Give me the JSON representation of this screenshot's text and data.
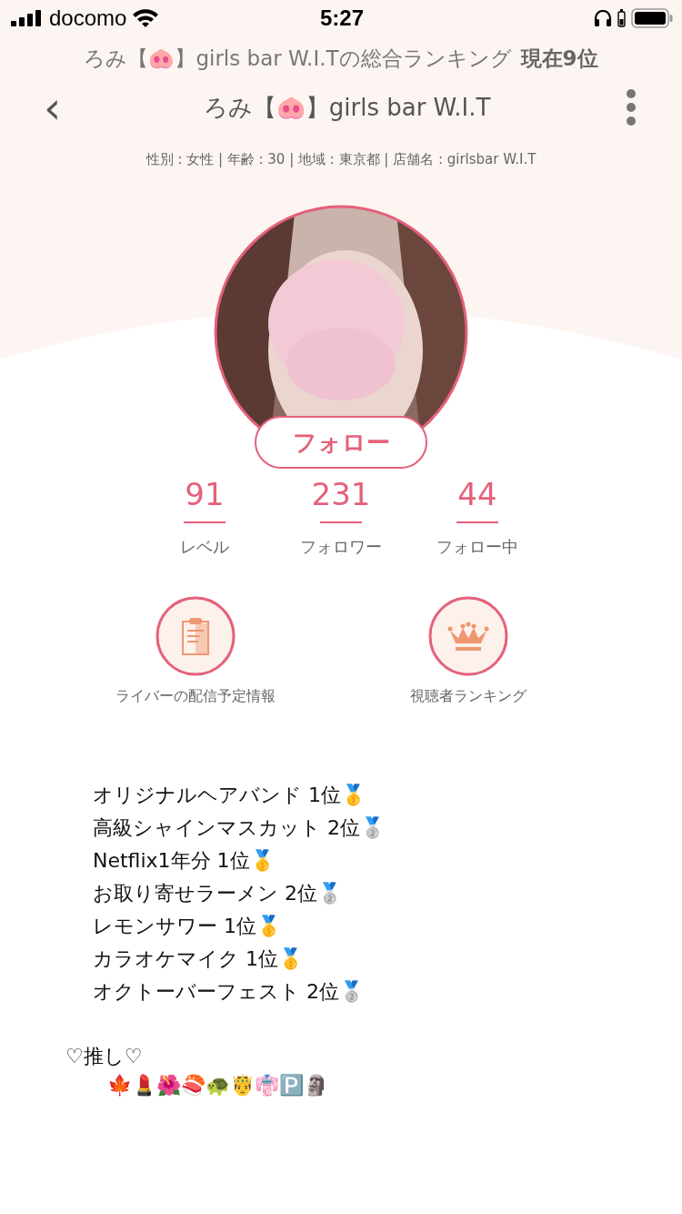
{
  "status_bar": {
    "carrier": "docomo",
    "time": "5:27"
  },
  "ranking_banner": {
    "text": "ろみ【🐽】girls bar W.I.Tの総合ランキング",
    "rank": "現在9位"
  },
  "nav": {
    "back": "‹",
    "title": "ろみ【🐽】girls bar W.I.T"
  },
  "profile_info": "性別 : 女性 | 年齢 : 30 | 地域 : 東京都 | 店舗名 : girlsbar W.I.T",
  "follow_button": "フォロー",
  "stats": [
    {
      "value": "91",
      "label": "レベル"
    },
    {
      "value": "231",
      "label": "フォロワー"
    },
    {
      "value": "44",
      "label": "フォロー中"
    }
  ],
  "actions": [
    {
      "kind": "schedule",
      "label": "ライバーの配信予定情報"
    },
    {
      "kind": "ranking",
      "label": "視聴者ランキング"
    }
  ],
  "bio_lines": [
    "オリジナルヘアバンド 1位🥇",
    "高級シャインマスカット 2位🥈",
    "Netflix1年分 1位🥇",
    "お取り寄せラーメン 2位🥈",
    "レモンサワー 1位🥇",
    "カラオケマイク 1位🥇",
    "オクトーバーフェスト 2位🥈"
  ],
  "oshi": {
    "title": "♡推し♡",
    "emojis": "🍁💄🌺🍣🐢🤴👘🅿️🗿"
  }
}
